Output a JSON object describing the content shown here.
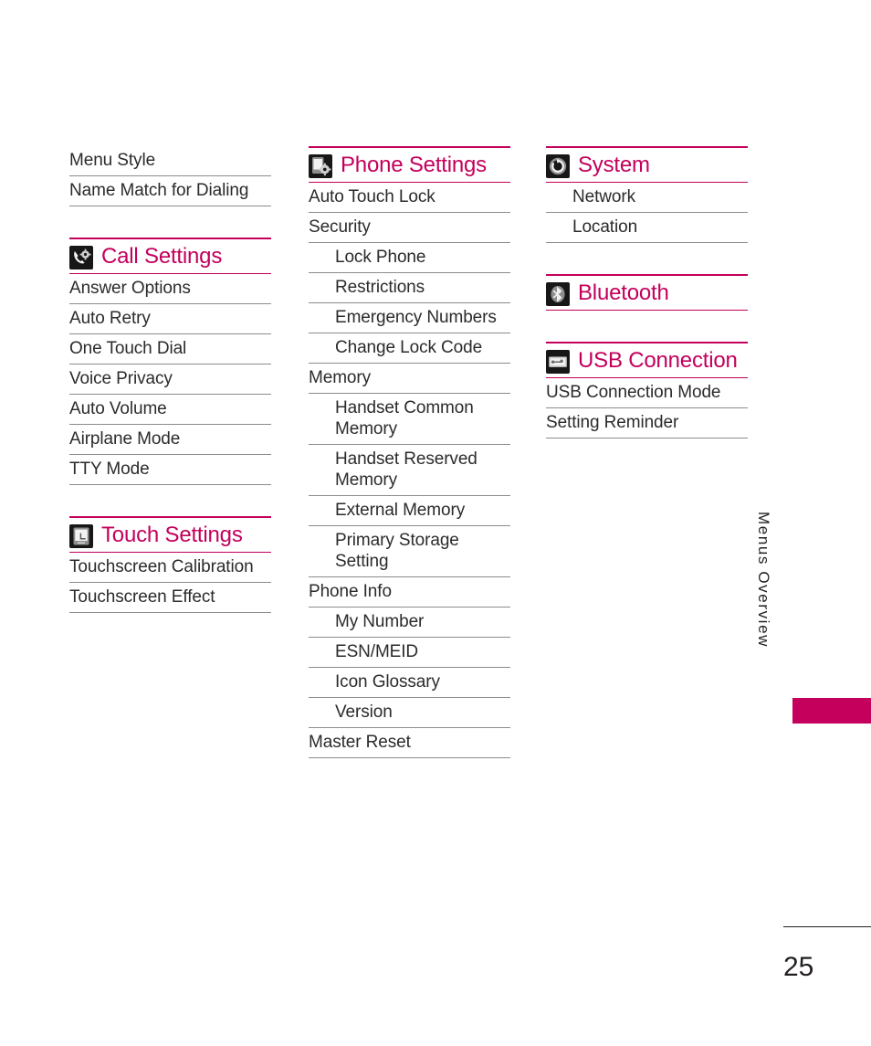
{
  "page": {
    "number": "25",
    "side_tab_label": "Menus Overview",
    "accent_color": "#c4005c",
    "text_color": "#231f20",
    "rule_color": "#8c8c8c"
  },
  "columns": [
    {
      "id": "column-1",
      "sections": [
        {
          "id": "continued-settings",
          "heading": null,
          "icon": null,
          "rows": [
            {
              "label": "Menu Style",
              "level": 1
            },
            {
              "label": "Name Match for Dialing",
              "level": 1
            }
          ]
        },
        {
          "id": "call-settings",
          "heading": "Call Settings",
          "icon": "phone-gear-icon",
          "rows": [
            {
              "label": "Answer Options",
              "level": 1
            },
            {
              "label": "Auto Retry",
              "level": 1
            },
            {
              "label": "One Touch Dial",
              "level": 1
            },
            {
              "label": "Voice Privacy",
              "level": 1
            },
            {
              "label": "Auto Volume",
              "level": 1
            },
            {
              "label": "Airplane Mode",
              "level": 1
            },
            {
              "label": "TTY Mode",
              "level": 1
            }
          ]
        },
        {
          "id": "touch-settings",
          "heading": "Touch Settings",
          "icon": "touchscreen-icon",
          "rows": [
            {
              "label": "Touchscreen Calibration",
              "level": 1
            },
            {
              "label": "Touchscreen Effect",
              "level": 1
            }
          ]
        }
      ]
    },
    {
      "id": "column-2",
      "sections": [
        {
          "id": "phone-settings",
          "heading": "Phone Settings",
          "icon": "phone-settings-icon",
          "rows": [
            {
              "label": "Auto Touch Lock",
              "level": 1
            },
            {
              "label": "Security",
              "level": 1
            },
            {
              "label": "Lock Phone",
              "level": 2
            },
            {
              "label": "Restrictions",
              "level": 2
            },
            {
              "label": "Emergency Numbers",
              "level": 2
            },
            {
              "label": "Change Lock Code",
              "level": 2
            },
            {
              "label": "Memory",
              "level": 1
            },
            {
              "label": "Handset Common Memory",
              "level": 2
            },
            {
              "label": "Handset Reserved Memory",
              "level": 2
            },
            {
              "label": "External Memory",
              "level": 2
            },
            {
              "label": "Primary Storage Setting",
              "level": 2
            },
            {
              "label": "Phone Info",
              "level": 1
            },
            {
              "label": "My Number",
              "level": 2
            },
            {
              "label": "ESN/MEID",
              "level": 2
            },
            {
              "label": "Icon Glossary",
              "level": 2
            },
            {
              "label": "Version",
              "level": 2
            },
            {
              "label": "Master Reset",
              "level": 1
            }
          ]
        }
      ]
    },
    {
      "id": "column-3",
      "sections": [
        {
          "id": "system",
          "heading": "System",
          "icon": "system-refresh-icon",
          "rows": [
            {
              "label": "Network",
              "level": 2
            },
            {
              "label": "Location",
              "level": 2
            }
          ]
        },
        {
          "id": "bluetooth",
          "heading": "Bluetooth",
          "icon": "bluetooth-icon",
          "rows": []
        },
        {
          "id": "usb-connection",
          "heading": "USB Connection",
          "icon": "usb-icon",
          "rows": [
            {
              "label": "USB Connection Mode",
              "level": 1
            },
            {
              "label": "Setting Reminder",
              "level": 1
            }
          ]
        }
      ]
    }
  ]
}
